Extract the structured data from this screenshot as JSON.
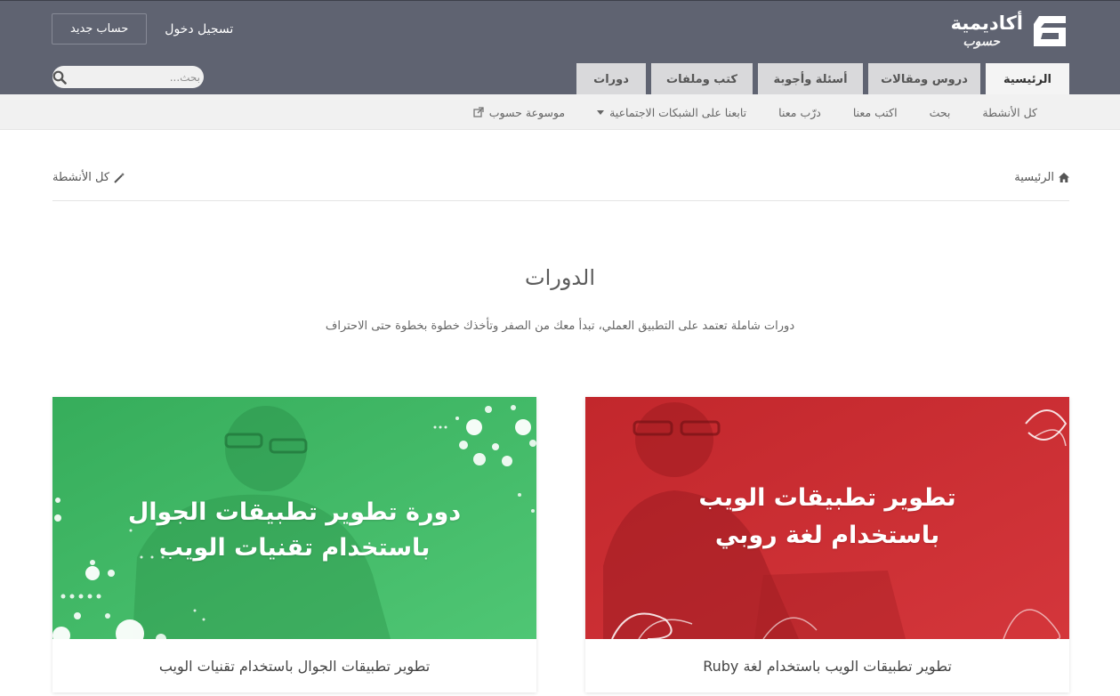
{
  "header": {
    "logo_title": "أكاديمية",
    "logo_sub": "حسوب",
    "register_label": "حساب جديد",
    "login_label": "تسجيل دخول",
    "search_placeholder": "بحث..."
  },
  "main_tabs": [
    {
      "label": "الرئيسية",
      "active": true
    },
    {
      "label": "دروس ومقالات",
      "active": false
    },
    {
      "label": "أسئلة وأجوبة",
      "active": false
    },
    {
      "label": "كتب وملفات",
      "active": false
    },
    {
      "label": "دورات",
      "active": false
    }
  ],
  "subnav": [
    {
      "label": "كل الأنشطة"
    },
    {
      "label": "بحث"
    },
    {
      "label": "اكتب معنا"
    },
    {
      "label": "درّب معنا"
    },
    {
      "label": "تابعنا على الشبكات الاجتماعية"
    },
    {
      "label": "موسوعة حسوب"
    }
  ],
  "breadcrumb": {
    "home_label": "الرئيسية",
    "activity_label": "كل الأنشطة"
  },
  "page": {
    "title": "الدورات",
    "description": "دورات شاملة تعتمد على التطبيق العملي، تبدأ معك من الصفر وتأخذك خطوة بخطوة حتى الاحتراف"
  },
  "courses": [
    {
      "image_line1": "تطوير تطبيقات الويب",
      "image_line2": "باستخدام لغة روبي",
      "caption": "تطوير تطبيقات الويب باستخدام لغة Ruby",
      "color": "#c8232b"
    },
    {
      "image_line1": "دورة تطوير تطبيقات الجوال",
      "image_line2": "باستخدام تقنيات الويب",
      "caption": "تطوير تطبيقات الجوال باستخدام تقنيات الويب",
      "color": "#3fb764"
    }
  ]
}
